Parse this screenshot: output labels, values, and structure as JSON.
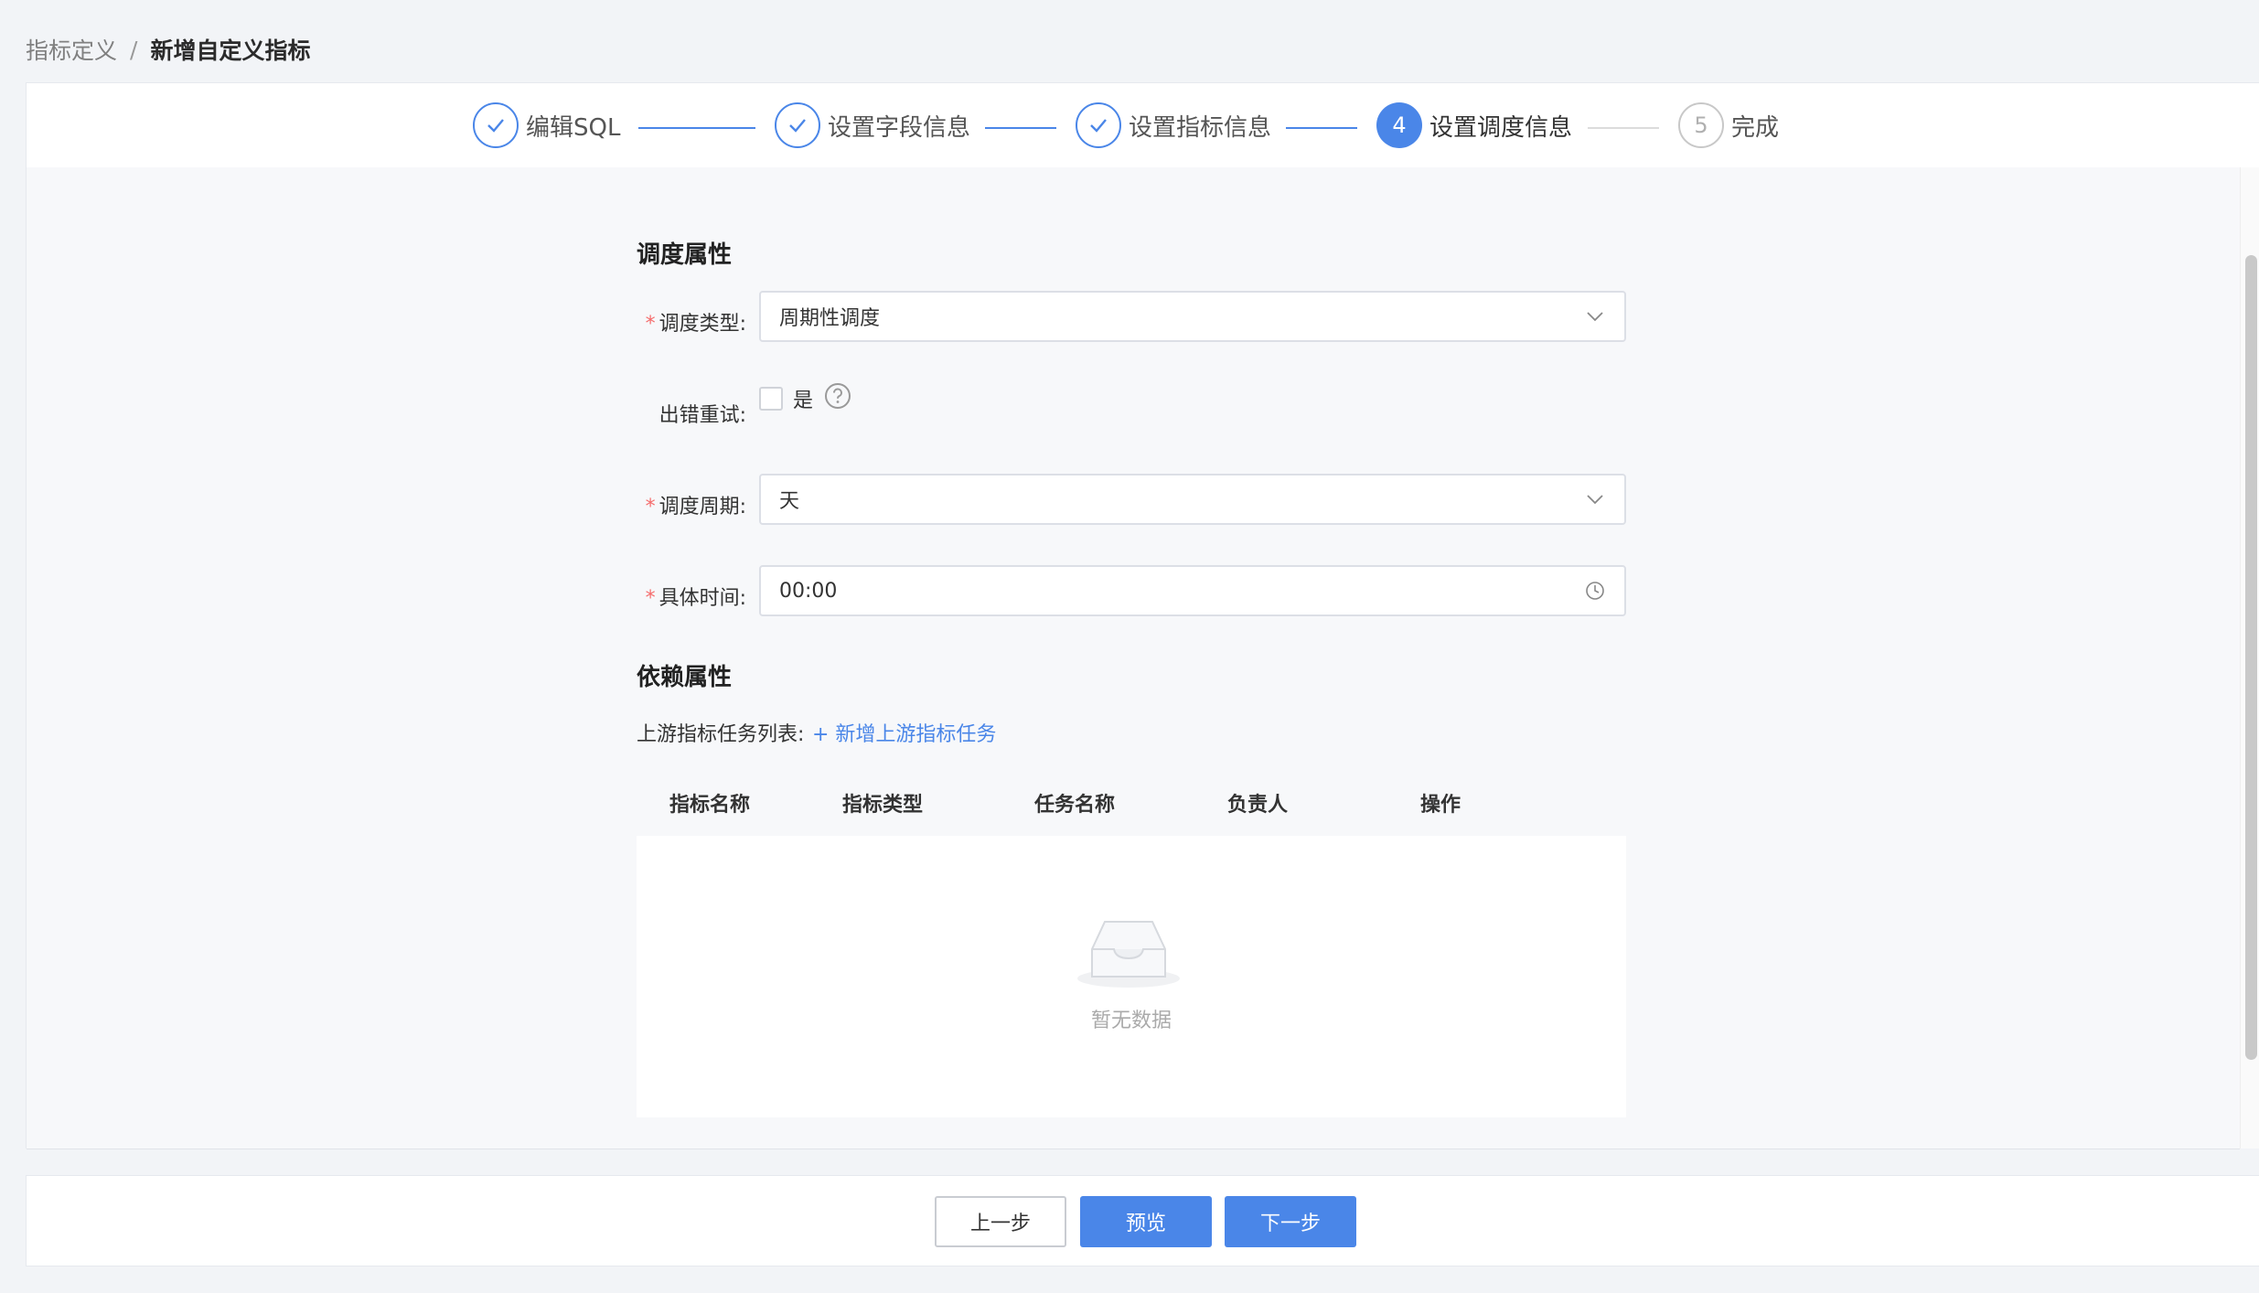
{
  "breadcrumb": {
    "parent": "指标定义",
    "separator": "/",
    "current": "新增自定义指标"
  },
  "steps": [
    {
      "label": "编辑SQL",
      "status": "done",
      "number": "1"
    },
    {
      "label": "设置字段信息",
      "status": "done",
      "number": "2"
    },
    {
      "label": "设置指标信息",
      "status": "done",
      "number": "3"
    },
    {
      "label": "设置调度信息",
      "status": "active",
      "number": "4"
    },
    {
      "label": "完成",
      "status": "todo",
      "number": "5"
    }
  ],
  "schedule": {
    "section_title": "调度属性",
    "type_label": "调度类型:",
    "type_value": "周期性调度",
    "retry_label": "出错重试:",
    "retry_option": "是",
    "retry_checked": false,
    "period_label": "调度周期:",
    "period_value": "天",
    "time_label": "具体时间:",
    "time_value": "00:00",
    "required_mark": "*"
  },
  "dependency": {
    "section_title": "依赖属性",
    "list_label": "上游指标任务列表:",
    "add_link": "+ 新增上游指标任务",
    "columns": [
      "指标名称",
      "指标类型",
      "任务名称",
      "负责人",
      "操作"
    ],
    "rows": [],
    "empty_text": "暂无数据"
  },
  "footer": {
    "prev_label": "上一步",
    "preview_label": "预览",
    "next_label": "下一步"
  },
  "colors": {
    "accent": "#4a86e8",
    "required": "#f56c6c"
  },
  "icons": {
    "step_done": "check-circle-icon",
    "select_arrow": "chevron-down-icon",
    "time": "clock-icon",
    "help": "question-circle-icon",
    "empty": "inbox-icon"
  }
}
